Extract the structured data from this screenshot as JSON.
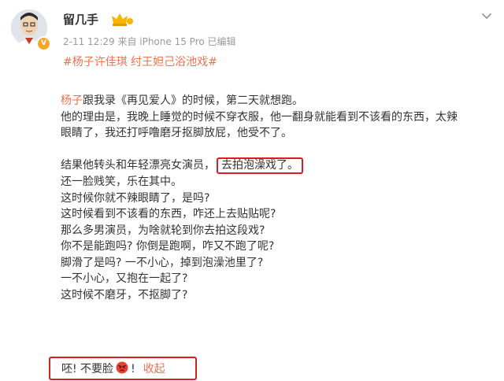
{
  "header": {
    "user_name": "留几手",
    "meta": "2-11 12:29  来自 iPhone 15 Pro 已编辑"
  },
  "post": {
    "topic": "#杨子许佳琪 纣王妲己浴池戏#",
    "line1_name": "杨子",
    "line1_rest": "跟我录《再见爱人》的时候，第二天就想跑。",
    "line2": "他的理由是，我晚上睡觉的时候不穿衣服，他一翻身就能看到不该看的东西，太辣",
    "line3": "眼睛了，我还打呼噜磨牙抠脚放屁，他受不了。",
    "line4_pre": "结果他转头和年轻漂亮女演员，",
    "line4_boxed": "去拍泡澡戏了。",
    "lines": [
      "还一脸贱笑，乐在其中。",
      "这时候你就不辣眼睛了，是吗?",
      "这时候看到不该看的东西，咋还上去贴贴呢?",
      "那么多男演员，为啥就轮到你去拍这段戏?",
      "你不是能跑吗? 你倒是跑啊，咋又不跑了呢?",
      "脚滑了是吗? 一不小心，掉到泡澡池里了?",
      "一不小心，又抱在一起了?",
      "这时候不磨牙，不抠脚了?"
    ],
    "closing_pre": "呸! 不要脸",
    "closing_post": "!",
    "collapse_label": "收起"
  },
  "colors": {
    "accent": "#eb7350",
    "highlight_box": "#d81e1e",
    "meta_text": "#999999"
  },
  "icons": [
    "avatar",
    "verified-badge-icon",
    "member-badge-icon",
    "chevron-down-icon",
    "angry-emoji-icon"
  ]
}
